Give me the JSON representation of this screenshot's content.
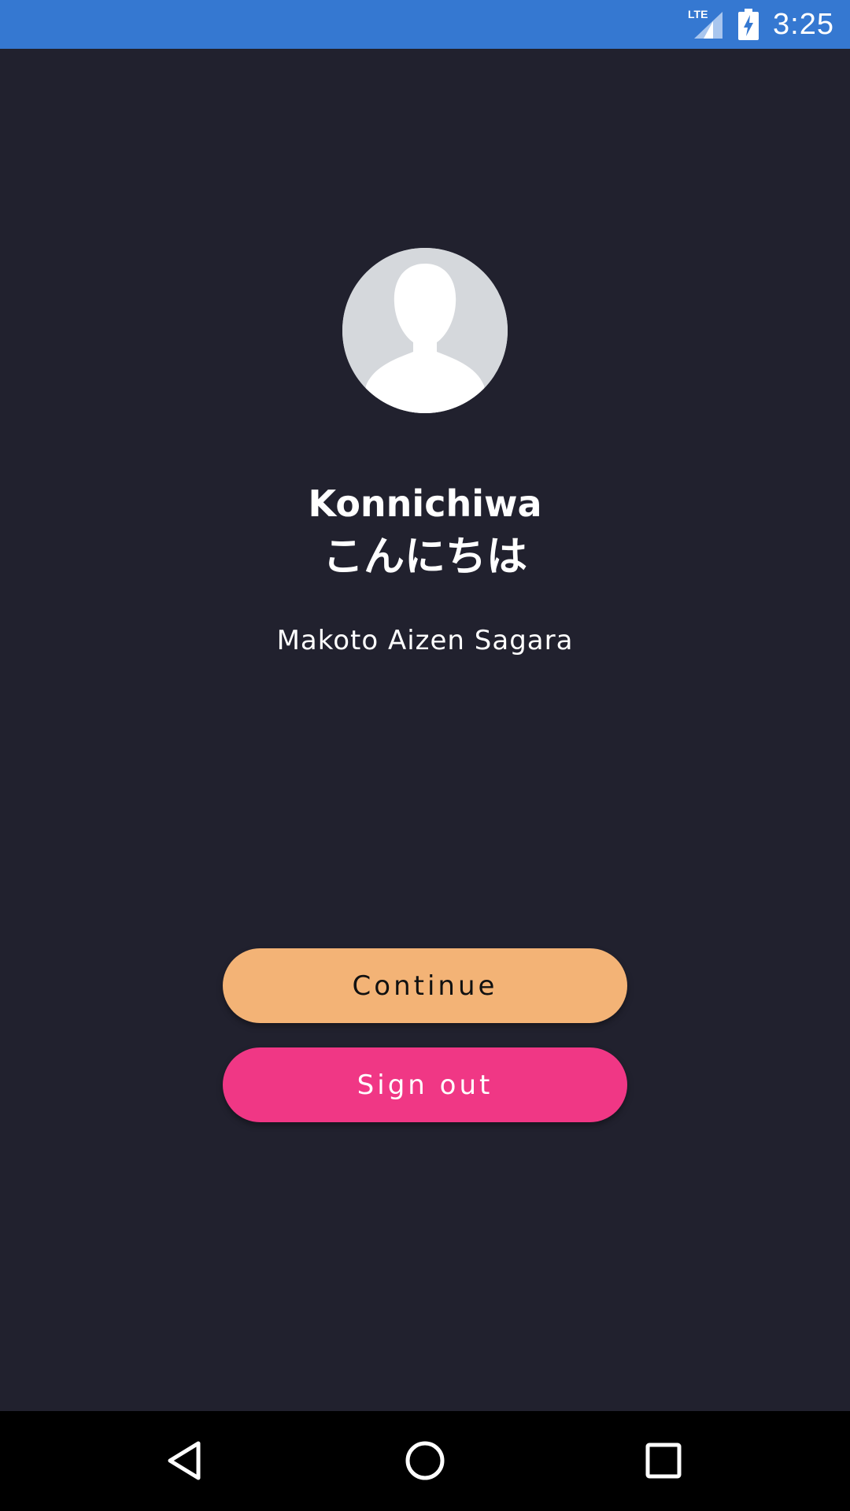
{
  "status_bar": {
    "network_label": "LTE",
    "time": "3:25",
    "background_color": "#3578d1"
  },
  "profile": {
    "avatar_icon": "default-person-avatar",
    "greeting_en": "Konnichiwa",
    "greeting_jp": "こんにちは",
    "user_name": "Makoto Aizen Sagara"
  },
  "actions": {
    "continue_label": "Continue",
    "continue_color": "#f3b376",
    "sign_out_label": "Sign out",
    "sign_out_color": "#f03785"
  },
  "navigation": {
    "back_icon": "triangle-back-icon",
    "home_icon": "circle-home-icon",
    "recents_icon": "square-recents-icon"
  },
  "theme": {
    "background": "#21212e"
  }
}
